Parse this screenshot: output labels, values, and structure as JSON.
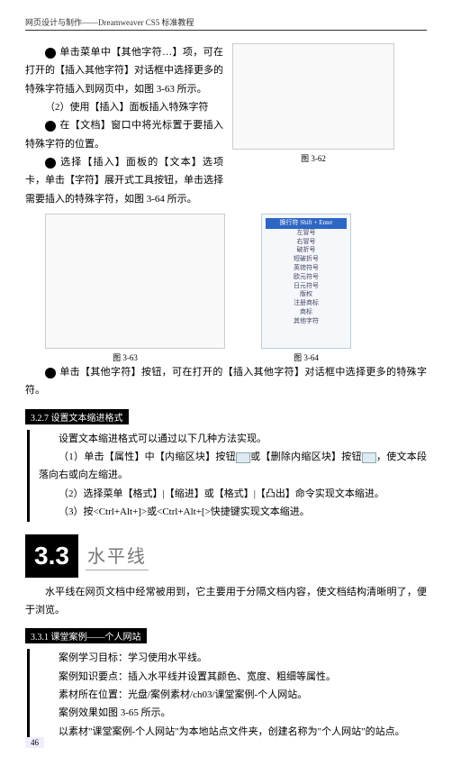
{
  "header": "网页设计与制作——Dreamweaver CS5 标准教程",
  "top_left": [
    {
      "b": "3",
      "t": "单击菜单中【其他字符…】项，可在打开的【插入其他字符】对话框中选择更多的特殊字符插入到网页中，如图 3-63 所示。"
    },
    {
      "t": "（2）使用【插入】面板插入特殊字符"
    },
    {
      "b": "1",
      "t": "在【文档】窗口中将光标置于要插入特殊字符的位置。"
    },
    {
      "b": "2",
      "t": "选择【插入】面板的【文本】选项卡，单击【字符】展开式工具按钮，单击选择需要插入的特殊字符，如图 3-64 所示。"
    }
  ],
  "cap362": "图 3-62",
  "cap363": "图 3-63",
  "cap364": "图 3-64",
  "line_after_figs": {
    "b": "3",
    "t": "单击【其他字符】按钮，可在打开的【插入其他字符】对话框中选择更多的特殊字符。"
  },
  "sec327": "3.2.7  设置文本缩进格式",
  "sec327_intro": "设置文本缩进格式可以通过以下几种方法实现。",
  "sec327_items": [
    "（1）单击【属性】中【内缩区块】按钮  或【删除内缩区块】按钮  ，使文本段落向右或向左缩进。",
    "（2）选择菜单【格式】|【缩进】或【格式】|【凸出】命令实现文本缩进。",
    "（3）按<Ctrl+Alt+]>或<Ctrl+Alt+[>快捷键实现文本缩进。"
  ],
  "big_num": "3.3",
  "big_title": "水平线",
  "hr_intro": "水平线在网页文档中经常被用到，它主要用于分隔文档内容，使文档结构清晰明了，便于浏览。",
  "sec331": "3.3.1  课堂案例——个人网站",
  "case_items": [
    "案例学习目标：学习使用水平线。",
    "案例知识要点：插入水平线并设置其颜色、宽度、粗细等属性。",
    "素材所在位置：光盘/案例素材/ch03/课堂案例-个人网站。",
    "案例效果如图 3-65 所示。",
    "以素材\"课堂案例-个人网站\"为本地站点文件夹，创建名称为\"个人网站\"的站点。"
  ],
  "page_num": "46",
  "fig364_menu": {
    "hi": "换行符 Shift + Enter",
    "items": [
      "左冒号",
      "右冒号",
      "破折号",
      "短破折号",
      "英镑符号",
      "欧元符号",
      "日元符号",
      "版权",
      "注册商标",
      "商标",
      "其他字符"
    ]
  },
  "chart_data": null
}
